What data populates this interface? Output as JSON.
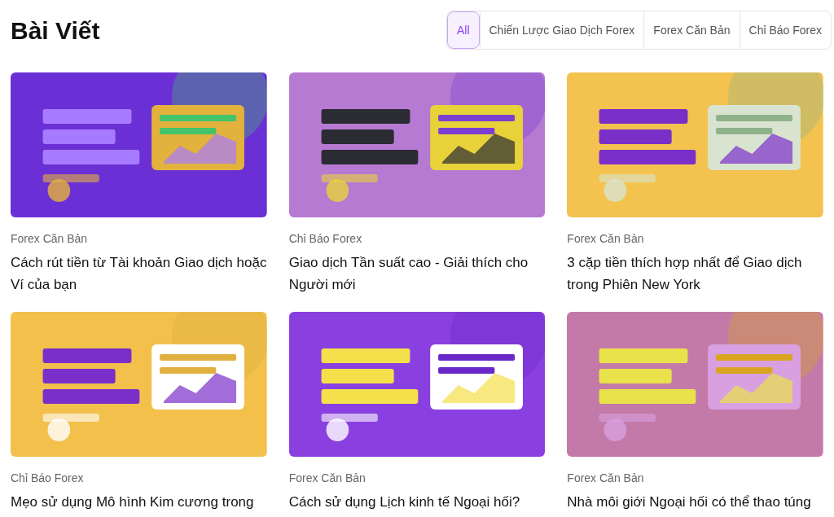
{
  "page_title": "Bài Viết",
  "tabs": [
    {
      "label": "All",
      "selected": true
    },
    {
      "label": "Chiến Lược Giao Dịch Forex",
      "selected": false
    },
    {
      "label": "Forex Căn Bản",
      "selected": false
    },
    {
      "label": "Chỉ Báo Forex",
      "selected": false
    }
  ],
  "articles": [
    {
      "category": "Forex Căn Bản",
      "title": "Cách rút tiền từ Tài khoản Giao dịch hoặc Ví của bạn"
    },
    {
      "category": "Chỉ Báo Forex",
      "title": "Giao dịch Tần suất cao - Giải thích cho Người mới"
    },
    {
      "category": "Forex Căn Bản",
      "title": "3 cặp tiền thích hợp nhất để Giao dịch trong Phiên New York"
    },
    {
      "category": "Chỉ Báo Forex",
      "title": "Mẹo sử dụng Mô hình Kim cương trong"
    },
    {
      "category": "Forex Căn Bản",
      "title": "Cách sử dụng Lịch kinh tế Ngoại hối?"
    },
    {
      "category": "Forex Căn Bản",
      "title": "Nhà môi giới Ngoại hối có thể thao túng"
    }
  ]
}
